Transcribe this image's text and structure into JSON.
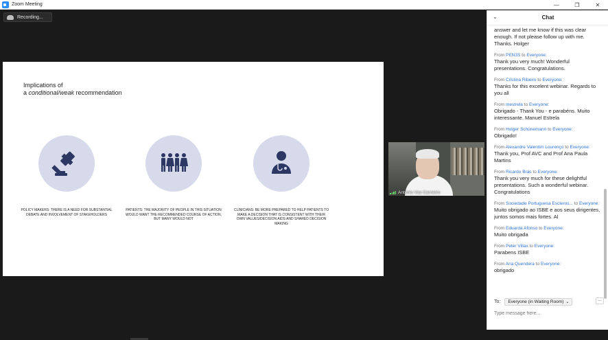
{
  "window": {
    "title": "Zoom Meeting",
    "controls": {
      "minimize": "—",
      "maximize": "❐",
      "close": "✕"
    }
  },
  "recording": {
    "label": "Recording..."
  },
  "slide": {
    "heading_line1": "Implications of",
    "heading_prefix": "a ",
    "heading_italic": "conditional/weak",
    "heading_suffix": " recommendation",
    "items": [
      {
        "icon": "gavel-icon",
        "caption": "POLICY MAKERS: THERE IS A NEED FOR SUBSTANTIAL DEBATE AND INVOLVEMENT OF STAKEHOLDERS"
      },
      {
        "icon": "people-group-icon",
        "caption": "PATIENTS: THE MAJORITY OF PEOPLE IN THIS SITUATION WOULD WANT THE RECOMMENDED COURSE OF ACTION, BUT MANY WOULD NOT"
      },
      {
        "icon": "doctor-icon",
        "caption": "CLINICIANS: BE MORE PREPARED TO HELP PATIENTS TO MAKE A DECISION THAT IS CONSISTENT WITH THEIR OWN VALUES/DECISION AIDS AND SHARED DECISION MAKING"
      }
    ],
    "icon_color": "#2c3763",
    "circle_color": "#d6daea"
  },
  "video": {
    "participant_name": "António Vaz Carneiro"
  },
  "chat": {
    "title": "Chat",
    "messages": [
      {
        "from": "",
        "to": "",
        "text": "answer and let me know if this was clear enough. If not please follow up with me. Thanks. Holger"
      },
      {
        "from": "PEN3S",
        "to": "Everyone:",
        "text": "Thank you very much! Wonderful presentations. Congratulations."
      },
      {
        "from": "Cristina Ribeiro",
        "to": "Everyone:",
        "text": "Thanks for this excelent webinar. Regards to you all"
      },
      {
        "from": "mestrela",
        "to": "Everyone:",
        "text": "Obrigado - Thank You -  e parabéns. Muito interessante. Manuel Estrela"
      },
      {
        "from": "Holger Schünemann",
        "to": "Everyone:",
        "text": "Obrigado!"
      },
      {
        "from": "Alexandre Valentim Lourenço",
        "to": "Everyone:",
        "text": "Thank you, Prof AVC and Prof Ana Paula Martins"
      },
      {
        "from": "Ricardo Brás",
        "to": "Everyone:",
        "text": "Thank you very much for these delightful presentations. Such a wonderful webinar. Congratulations"
      },
      {
        "from": "Sociedade Portuguesa Escleros...",
        "to": "Everyone:",
        "text": "Muito obrigado ao ISBE e aos seus dirigentes, juntos somos mais fortes. Al"
      },
      {
        "from": "Eduarda Afonso",
        "to": "Everyone:",
        "text": "Muito obrigada"
      },
      {
        "from": "Peter Villax",
        "to": "Everyone:",
        "text": "Parabens ISBE"
      },
      {
        "from": "Ana Quendera",
        "to": "Everyone:",
        "text": "obrigado"
      }
    ],
    "from_word": "From",
    "to_word": "to",
    "to_label": "To:",
    "recipient": "Everyone (in Waiting Room)",
    "more": "...",
    "input_placeholder": "Type message here...",
    "link_color": "#2d74d9"
  }
}
